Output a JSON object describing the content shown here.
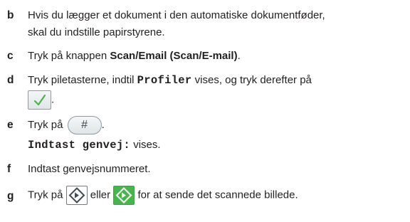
{
  "steps": [
    {
      "letter": "b",
      "line1": "Hvis du lægger et dokument i den automatiske dokumentføder,",
      "line2": "skal du indstille papirstyrene."
    },
    {
      "letter": "c",
      "prefix": "Tryk på knappen ",
      "bold": "Scan/Email (Scan/E-mail)",
      "suffix": "."
    },
    {
      "letter": "d",
      "prefix": "Tryk piletasterne, indtil ",
      "mono": "Profiler",
      "suffix": " vises, og tryk derefter på",
      "line2_suffix": "."
    },
    {
      "letter": "e",
      "prefix": "Tryk på ",
      "button_label": "#",
      "suffix": ".",
      "line2_mono": "Indtast genvej:",
      "line2_suffix": " vises."
    },
    {
      "letter": "f",
      "text": "Indtast genvejsnummeret."
    },
    {
      "letter": "g",
      "prefix": "Tryk på ",
      "middle": " eller ",
      "suffix": " for at sende det scannede billede."
    }
  ],
  "icons": {
    "select_button": "checkmark-icon",
    "hash_button": "hash-key-icon",
    "start_button": "start-diamond-icon",
    "start_button_green": "start-diamond-green-icon"
  },
  "colors": {
    "text": "#231f20",
    "check_mark": "#4cb34f",
    "start_green": "#45b649"
  }
}
